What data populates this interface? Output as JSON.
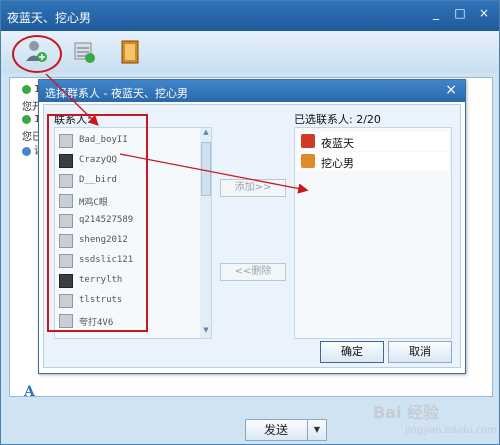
{
  "window": {
    "title": "夜蓝天、挖心男",
    "controls": [
      "_",
      "□",
      "×"
    ]
  },
  "toolbar": {
    "icons": [
      "add-contact-icon",
      "transfer-icon",
      "notebook-icon"
    ]
  },
  "chat": {
    "lines": [
      {
        "prefix": "1",
        "icon": "check-icon"
      },
      {
        "prefix": "您开",
        "icon": ""
      },
      {
        "prefix": "1",
        "icon": "check-icon"
      },
      {
        "prefix": "您已",
        "icon": ""
      },
      {
        "prefix": "读",
        "icon": "info-icon"
      }
    ],
    "font_icon": "A"
  },
  "send": {
    "label": "发送",
    "arrow": "▼"
  },
  "dialog": {
    "title": "选择群系人 - 夜蓝天、挖心男",
    "close": "×",
    "contacts_label": "联系人:",
    "contacts": [
      {
        "name": "Bad_boyII",
        "dark": false
      },
      {
        "name": "CrazyQQ",
        "dark": true
      },
      {
        "name": "D__bird",
        "dark": false
      },
      {
        "name": "M鸡C眼",
        "dark": false
      },
      {
        "name": "q214527589",
        "dark": false
      },
      {
        "name": "sheng2012",
        "dark": false
      },
      {
        "name": "ssdslic121",
        "dark": false
      },
      {
        "name": "terrylth",
        "dark": true
      },
      {
        "name": "tlstruts",
        "dark": false
      },
      {
        "name": "夸打4V6",
        "dark": false
      }
    ],
    "add_label": "添加>>",
    "remove_label": "<<删除",
    "selected_label": "已选联系人: 2/20",
    "selected": [
      {
        "name": "夜蓝天",
        "color": "#d23a26"
      },
      {
        "name": "挖心男",
        "color": "#e08a2a"
      }
    ],
    "ok_label": "确定",
    "cancel_label": "取消"
  },
  "watermark": {
    "main": "Bai 经验",
    "sub": "jingyan.baidu.com"
  },
  "colors": {
    "annotation_red": "#c8171e",
    "title_blue": "#2f73b8"
  }
}
